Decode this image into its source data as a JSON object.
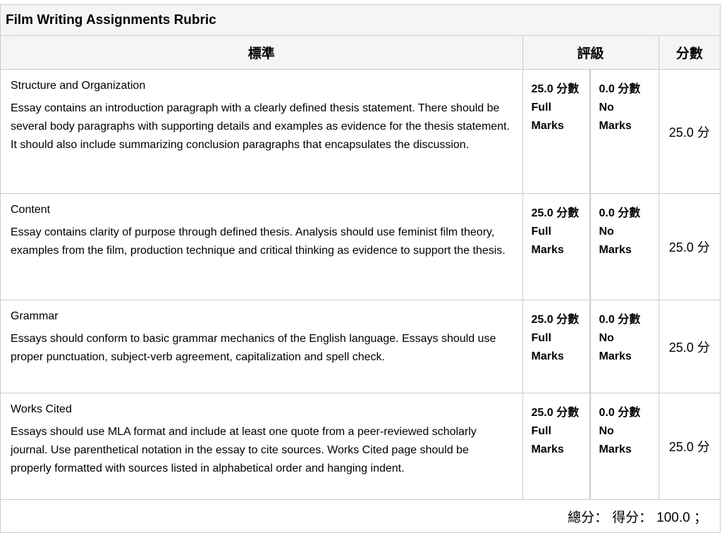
{
  "rubric": {
    "title": "Film Writing Assignments Rubric",
    "headers": {
      "criteria": "標準",
      "ratings": "評級",
      "points": "分數"
    },
    "criteria": [
      {
        "name": "Structure and Organization",
        "description": "Essay contains an introduction paragraph with a clearly defined thesis statement. There should be several body paragraphs with supporting details and examples as evidence for the thesis statement. It should also include summarizing conclusion paragraphs that encapsulates the discussion.",
        "ratings": [
          {
            "points": "25.0 分數",
            "label1": "Full",
            "label2": "Marks"
          },
          {
            "points": "0.0 分數",
            "label1": "No",
            "label2": "Marks"
          }
        ],
        "points": "25.0 分"
      },
      {
        "name": "Content",
        "description": "Essay contains clarity of purpose through defined thesis. Analysis should use feminist film theory, examples from the film, production technique and critical thinking as evidence to support the thesis.",
        "ratings": [
          {
            "points": "25.0 分數",
            "label1": "Full",
            "label2": "Marks"
          },
          {
            "points": "0.0 分數",
            "label1": "No",
            "label2": "Marks"
          }
        ],
        "points": "25.0 分"
      },
      {
        "name": "Grammar",
        "description": "Essays should conform to basic grammar mechanics of the English language. Essays should use proper punctuation, subject-verb agreement, capitalization and spell check.",
        "ratings": [
          {
            "points": "25.0 分數",
            "label1": "Full",
            "label2": "Marks"
          },
          {
            "points": "0.0 分數",
            "label1": "No",
            "label2": "Marks"
          }
        ],
        "points": "25.0 分"
      },
      {
        "name": "Works Cited",
        "description": "Essays should use MLA format and include at least one quote from a peer-reviewed scholarly journal. Use parenthetical notation in the essay to cite sources. Works Cited page should be properly formatted with sources listed in alphabetical order and hanging indent.",
        "ratings": [
          {
            "points": "25.0 分數",
            "label1": "Full",
            "label2": "Marks"
          },
          {
            "points": "0.0 分數",
            "label1": "No",
            "label2": "Marks"
          }
        ],
        "points": "25.0 分"
      }
    ],
    "total": {
      "label": "總分：",
      "score_label": "得分：",
      "value": "100.0 ；"
    }
  }
}
